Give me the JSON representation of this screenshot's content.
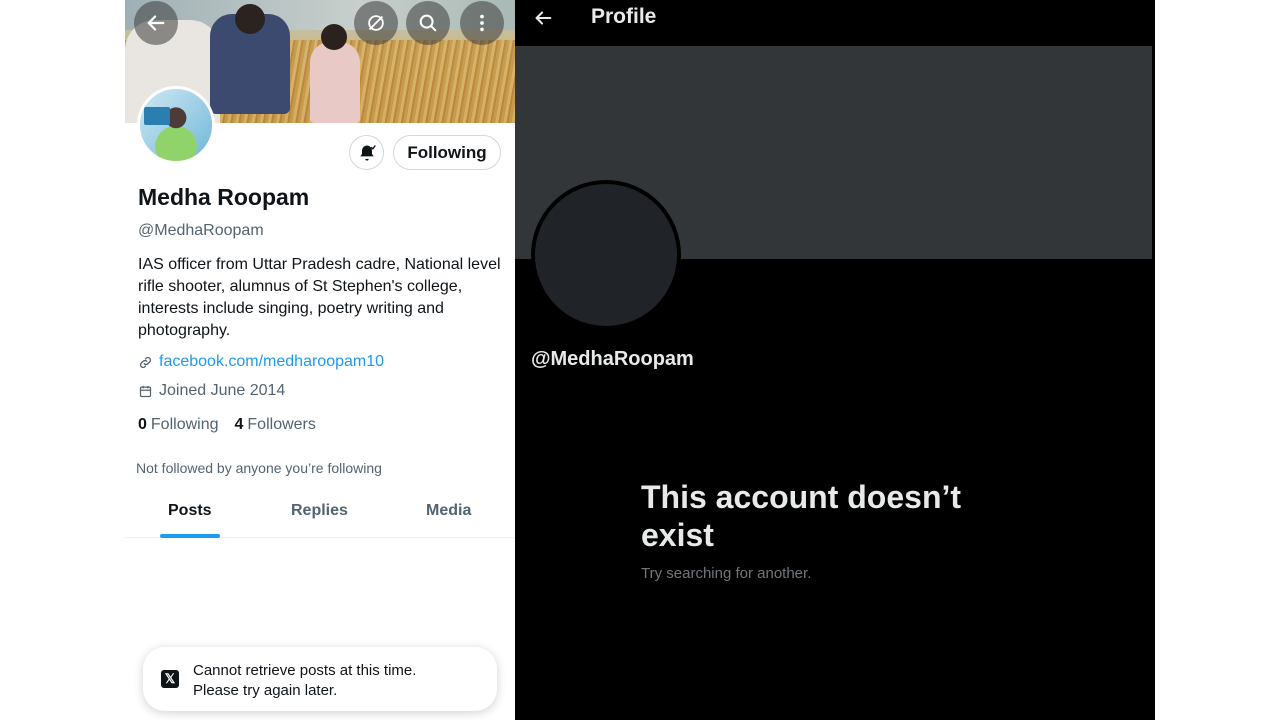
{
  "left_panel": {
    "profile": {
      "display_name": "Medha Roopam",
      "handle": "@MedhaRoopam",
      "bio": "IAS officer from Uttar Pradesh cadre, National level rifle shooter, alumnus of St Stephen's college, interests include singing, poetry writing and photography.",
      "link": "facebook.com/medharoopam10",
      "joined": "Joined June 2014",
      "following_count": "0",
      "following_label": "Following",
      "followers_count": "4",
      "followers_label": "Followers",
      "not_followed_note": "Not followed by anyone you’re following"
    },
    "buttons": {
      "following": "Following"
    },
    "tabs": [
      {
        "label": "Posts",
        "active": true
      },
      {
        "label": "Replies",
        "active": false
      },
      {
        "label": "Media",
        "active": false
      }
    ],
    "toast": {
      "logo": "𝕏",
      "line1": "Cannot retrieve posts at this time.",
      "line2": "Please try again later."
    },
    "icons": [
      "back-arrow-icon",
      "grok-icon",
      "search-icon",
      "more-vertical-icon",
      "bell-check-icon",
      "link-icon",
      "calendar-icon",
      "x-logo-icon"
    ]
  },
  "right_panel": {
    "header_title": "Profile",
    "handle": "@MedhaRoopam",
    "heading": "This account doesn’t exist",
    "subtext": "Try searching for another."
  },
  "colors": {
    "accent": "#1d9bf0",
    "dark_bg": "#000000",
    "dark_banner": "#333639",
    "muted_text": "#536471"
  }
}
